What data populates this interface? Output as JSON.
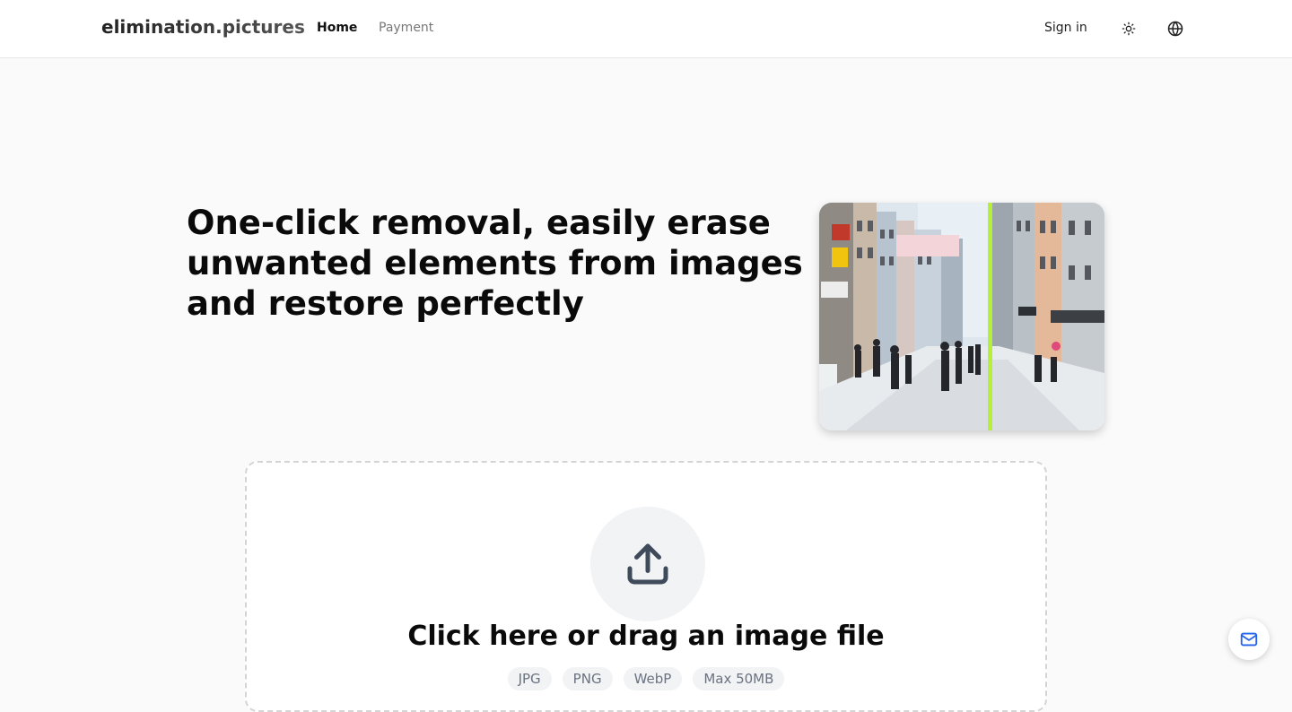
{
  "header": {
    "brand": "elimination.pictures",
    "nav": {
      "home": "Home",
      "payment": "Payment"
    },
    "sign_in": "Sign in",
    "icons": {
      "theme": "sun-icon",
      "language": "globe-icon"
    }
  },
  "hero": {
    "title": "One-click removal, easily erase unwanted elements from images and restore perfectly",
    "preview_image": "street-before-after-comparison",
    "divider_color": "#b5ef3a"
  },
  "upload": {
    "icon": "upload-icon",
    "title": "Click here or drag an image file",
    "formats": [
      "JPG",
      "PNG",
      "WebP",
      "Max 50MB"
    ]
  },
  "floating": {
    "mail_icon": "mail-icon",
    "accent": "#2563eb"
  }
}
